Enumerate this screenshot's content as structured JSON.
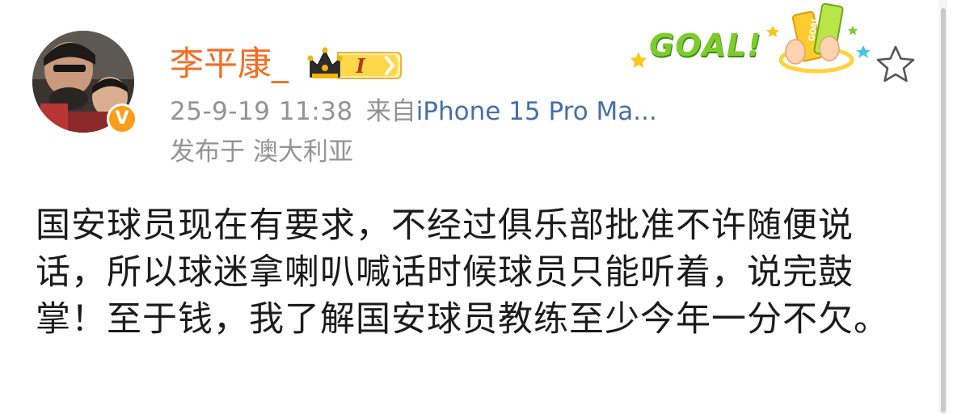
{
  "post": {
    "author": {
      "name": "李平康_",
      "verified_mark": "V",
      "level_badge": "I",
      "avatar_icon": "profile-photo"
    },
    "meta": {
      "timestamp": "25-9-19 11:38",
      "source_prefix": "来自",
      "device": "iPhone 15 Pro Ma...",
      "location_prefix": "发布于",
      "location": "澳大利亚"
    },
    "decoration": {
      "goal_text": "GOAL!",
      "sticker_text": "GOAL"
    },
    "content": "国安球员现在有要求，不经过俱乐部批准不许随便说话，所以球迷拿喇叭喊话时候球员只能听着，说完鼓掌！至于钱，我了解国安球员教练至少今年一分不欠。",
    "colors": {
      "username": "#f26d22",
      "meta_gray": "#939393",
      "device_link": "#476fa8",
      "verified_badge": "#ff9d1b",
      "goal_green": "#7ccd2b"
    }
  }
}
